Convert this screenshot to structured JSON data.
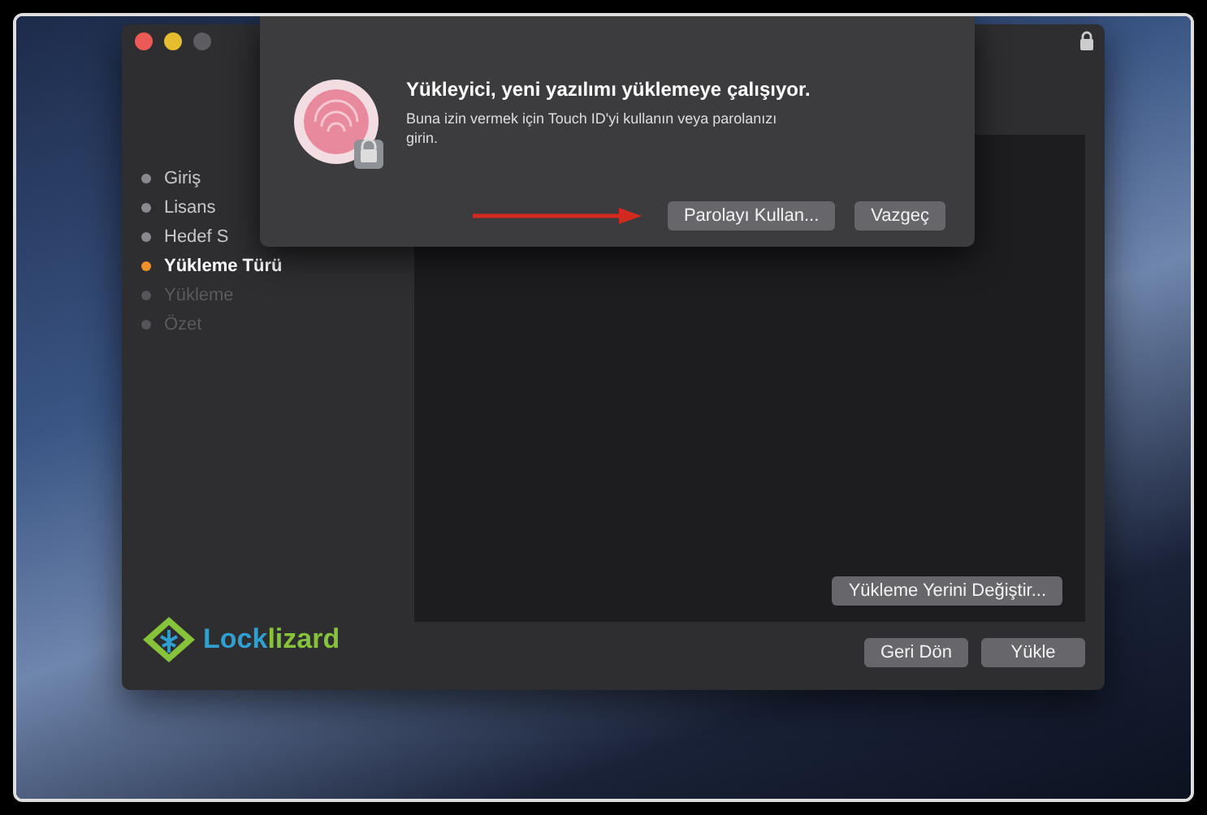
{
  "steps": [
    {
      "label": "Giriş",
      "selected": false,
      "disabled": false
    },
    {
      "label": "Lisans",
      "selected": false,
      "disabled": false
    },
    {
      "label": "Hedef S",
      "selected": false,
      "disabled": false
    },
    {
      "label": "Yükleme Türü",
      "selected": true,
      "disabled": false
    },
    {
      "label": "Yükleme",
      "selected": false,
      "disabled": true
    },
    {
      "label": "Özet",
      "selected": false,
      "disabled": true
    }
  ],
  "logo": {
    "parts": [
      {
        "text": "Lock",
        "color": "#2f9fd0"
      },
      {
        "text": "lizard",
        "color": "#86c23a"
      }
    ]
  },
  "change_location_button": "Yükleme Yerini Değiştir...",
  "buttons": [
    "Geri Dön",
    "Yükle"
  ],
  "dialog": {
    "title": "Yükleyici, yeni yazılımı yüklemeye çalışıyor.",
    "message": "Buna izin vermek için Touch ID'yi kullanın veya parolanızı girin.",
    "buttons": [
      "Parolayı Kullan...",
      "Vazgeç"
    ]
  }
}
